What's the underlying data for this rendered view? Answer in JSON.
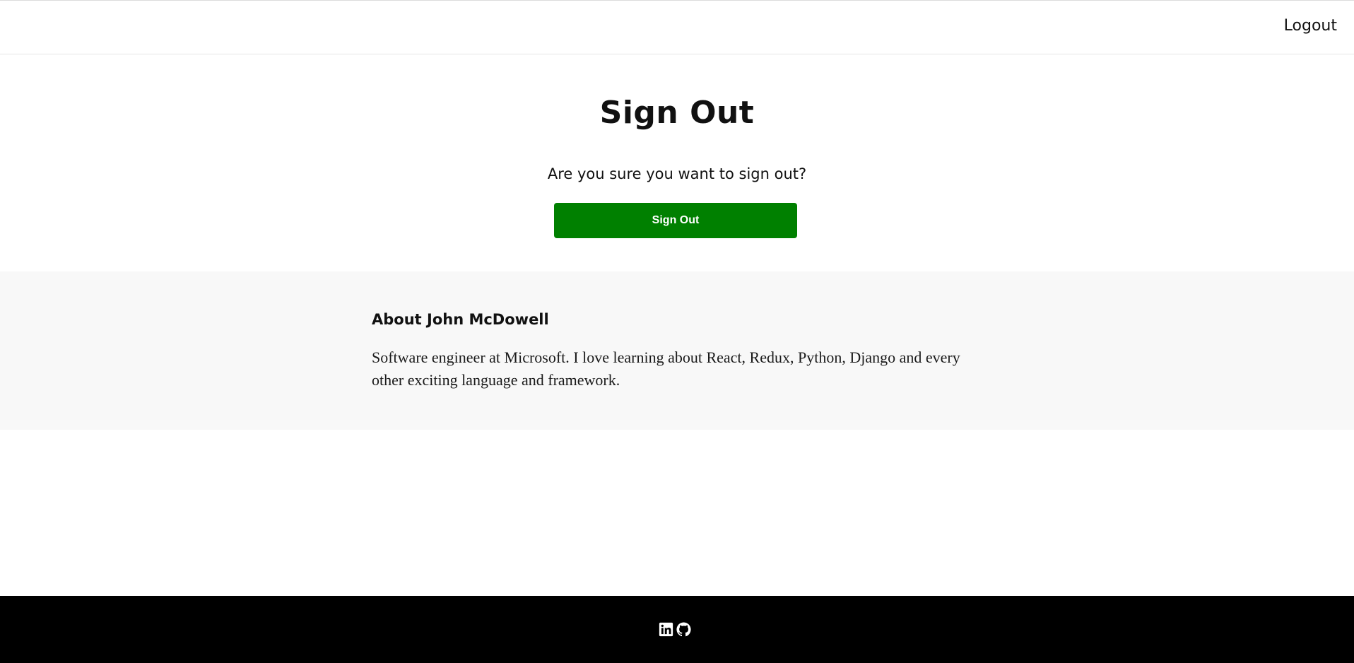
{
  "nav": {
    "logout_label": "Logout"
  },
  "signout": {
    "title": "Sign Out",
    "question": "Are you sure you want to sign out?",
    "button_label": "Sign Out",
    "button_color": "#008000"
  },
  "about": {
    "heading": "About John McDowell",
    "text": "Software engineer at Microsoft. I love learning about React, Redux, Python, Django and every other exciting language and framework.",
    "background": "#f8f8f8"
  },
  "footer": {
    "background": "#000000",
    "icons": [
      "linkedin-icon",
      "github-icon"
    ]
  }
}
